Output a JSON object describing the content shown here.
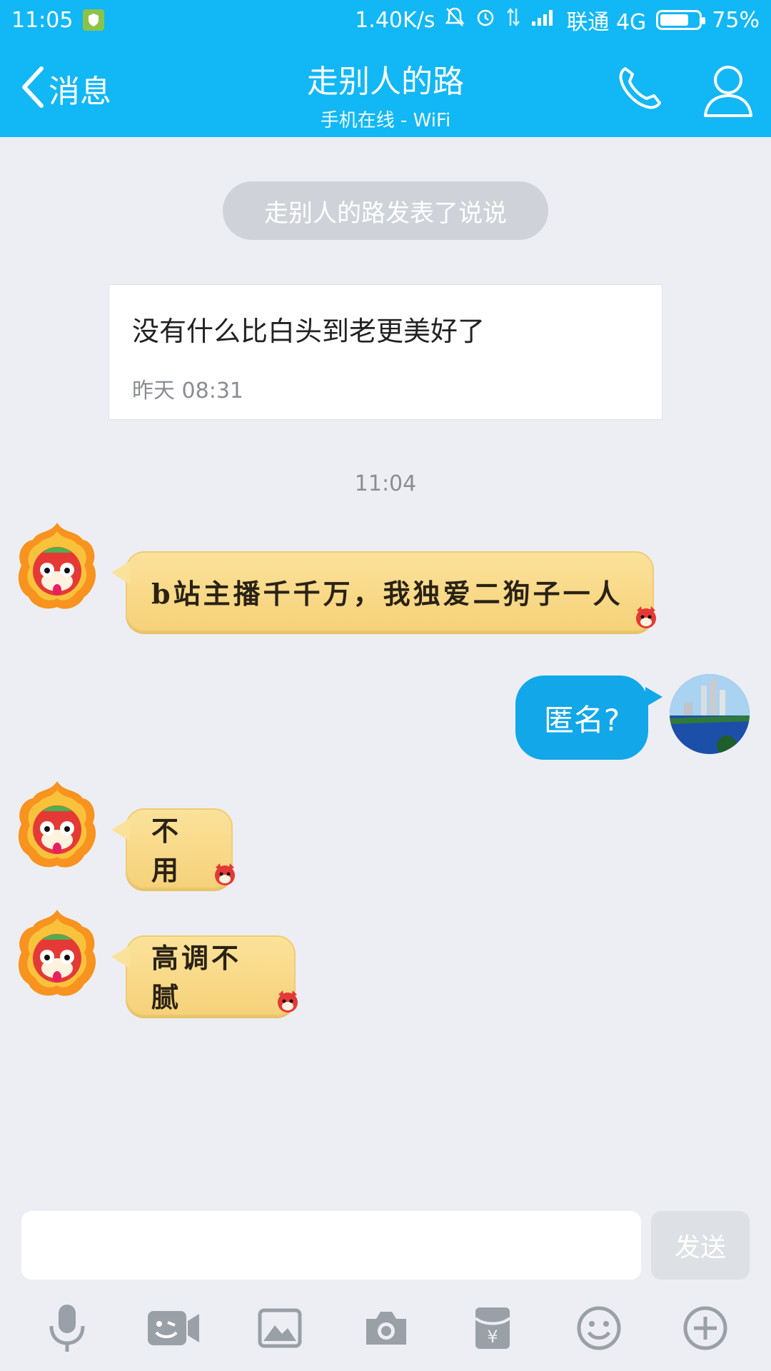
{
  "status_bar": {
    "time": "11:05",
    "speed": "1.40K/s",
    "carrier": "联通 4G",
    "battery_percent": "75%",
    "battery_level": 0.75
  },
  "nav": {
    "back_label": "消息",
    "title": "走别人的路",
    "subtitle": "手机在线 - WiFi"
  },
  "system_notice": "走别人的路发表了说说",
  "post": {
    "text": "没有什么比白头到老更美好了",
    "time": "昨天 08:31"
  },
  "time_divider": "11:04",
  "messages": [
    {
      "side": "left",
      "text": "b站主播千千万，我独爱二狗子一人"
    },
    {
      "side": "right",
      "text": "匿名?"
    },
    {
      "side": "left",
      "text": "不用"
    },
    {
      "side": "left",
      "text": "高调不腻"
    }
  ],
  "input": {
    "value": "",
    "send_label": "发送"
  },
  "toolbar_icons": [
    "microphone-icon",
    "video-icon",
    "image-icon",
    "camera-icon",
    "red-packet-icon",
    "emoji-icon",
    "plus-icon"
  ],
  "colors": {
    "accent": "#12b7f5",
    "bubble_blue": "#12a7e8",
    "bubble_yellow": "#fbe29a"
  }
}
